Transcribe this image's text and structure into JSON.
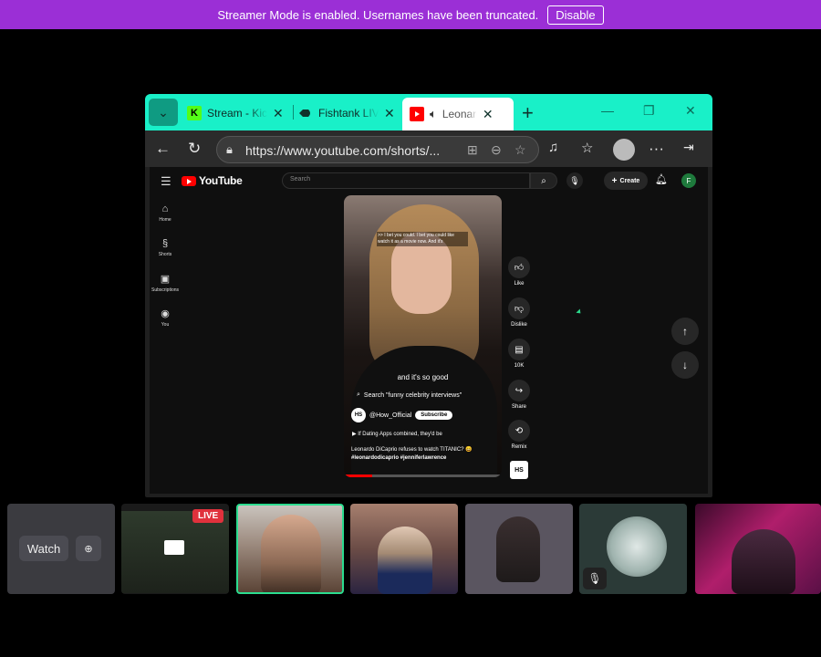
{
  "banner": {
    "message": "Streamer Mode is enabled. Usernames have been truncated.",
    "disable_label": "Disable",
    "color": "#9b2fd6"
  },
  "browser": {
    "accent": "#19f0c8",
    "tabs": [
      {
        "title": "Stream - Kick",
        "favicon": "K",
        "close": "✕"
      },
      {
        "title": "Fishtank LIVE",
        "favicon": "fish-icon",
        "close": "✕"
      },
      {
        "title": "Leonardo",
        "favicon": "youtube-icon",
        "close": "✕",
        "active": true
      }
    ],
    "new_tab": "+",
    "url": "https://www.youtube.com/shorts/..."
  },
  "youtube": {
    "logo_text": "YouTube",
    "search_placeholder": "Search",
    "create_label": "Create",
    "user_initial": "F",
    "sidebar": [
      {
        "label": "Home",
        "icon": "home-icon"
      },
      {
        "label": "Shorts",
        "icon": "shorts-icon"
      },
      {
        "label": "Subscriptions",
        "icon": "subscriptions-icon"
      },
      {
        "label": "You",
        "icon": "you-icon"
      }
    ],
    "short": {
      "caption_top": ">> I bet you could. I bet you could like watch it as a movie now. And it's",
      "caption_mid": "and it's so good",
      "search_suggestion": "Search \"funny celebrity interviews\"",
      "channel": "@How_Official",
      "channel_logo": "HS",
      "subscribe_label": "Subscribe",
      "related": "If Dating Apps combined, they'd be",
      "title": "Leonardo DiCaprio refuses to watch TITANIC? 😄",
      "hashtags": "#leonardodicaprio #jenniferlawrence",
      "progress": 0.18
    },
    "actions": [
      {
        "label": "Like",
        "icon": "like-icon"
      },
      {
        "label": "Dislike",
        "icon": "dislike-icon"
      },
      {
        "label": "10K",
        "icon": "comment-icon"
      },
      {
        "label": "Share",
        "icon": "share-icon"
      },
      {
        "label": "Remix",
        "icon": "remix-icon"
      }
    ]
  },
  "strip": {
    "watch_label": "Watch",
    "live_badge": "LIVE",
    "highlight_color": "#2bdc8f"
  }
}
